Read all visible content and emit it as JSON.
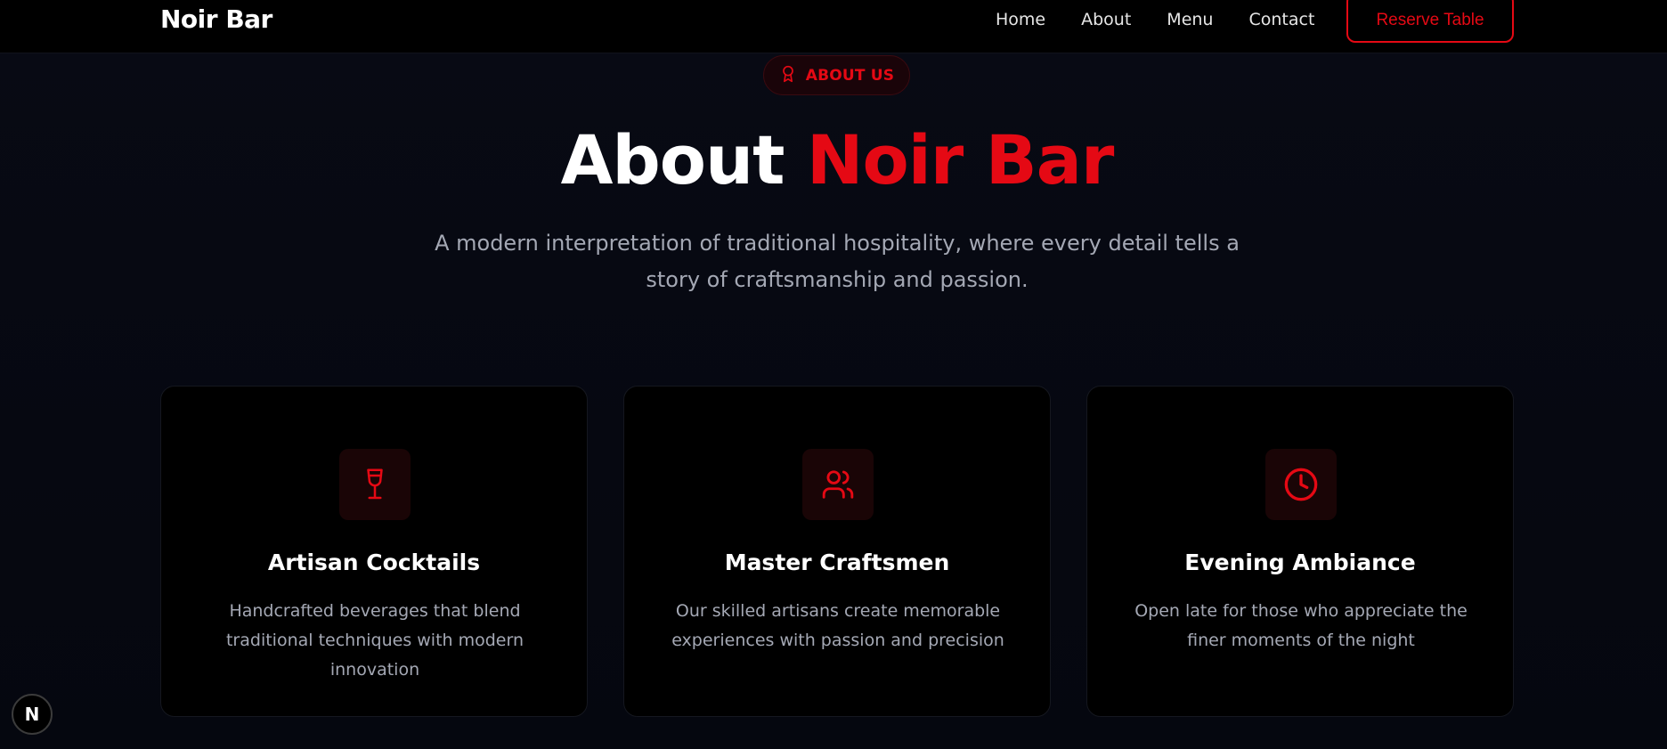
{
  "nav": {
    "brand": "Noir Bar",
    "links": [
      "Home",
      "About",
      "Menu",
      "Contact"
    ],
    "cta": "Reserve Table"
  },
  "badge": {
    "label": "ABOUT US",
    "icon": "award-icon"
  },
  "hero": {
    "title_plain": "About ",
    "title_accent": "Noir Bar",
    "subtitle": "A modern interpretation of traditional hospitality, where every detail tells a story of craftsmanship and passion."
  },
  "cards": [
    {
      "icon": "wine-glass-icon",
      "title": "Artisan Cocktails",
      "description": "Handcrafted beverages that blend traditional techniques with modern innovation"
    },
    {
      "icon": "users-icon",
      "title": "Master Craftsmen",
      "description": "Our skilled artisans create memorable experiences with passion and precision"
    },
    {
      "icon": "clock-icon",
      "title": "Evening Ambiance",
      "description": "Open late for those who appreciate the finer moments of the night"
    }
  ],
  "fab": {
    "label": "N"
  },
  "colors": {
    "accent": "#e50914",
    "background": "#05070f",
    "card_bg": "#000000",
    "muted_text": "#a4a8b4"
  }
}
